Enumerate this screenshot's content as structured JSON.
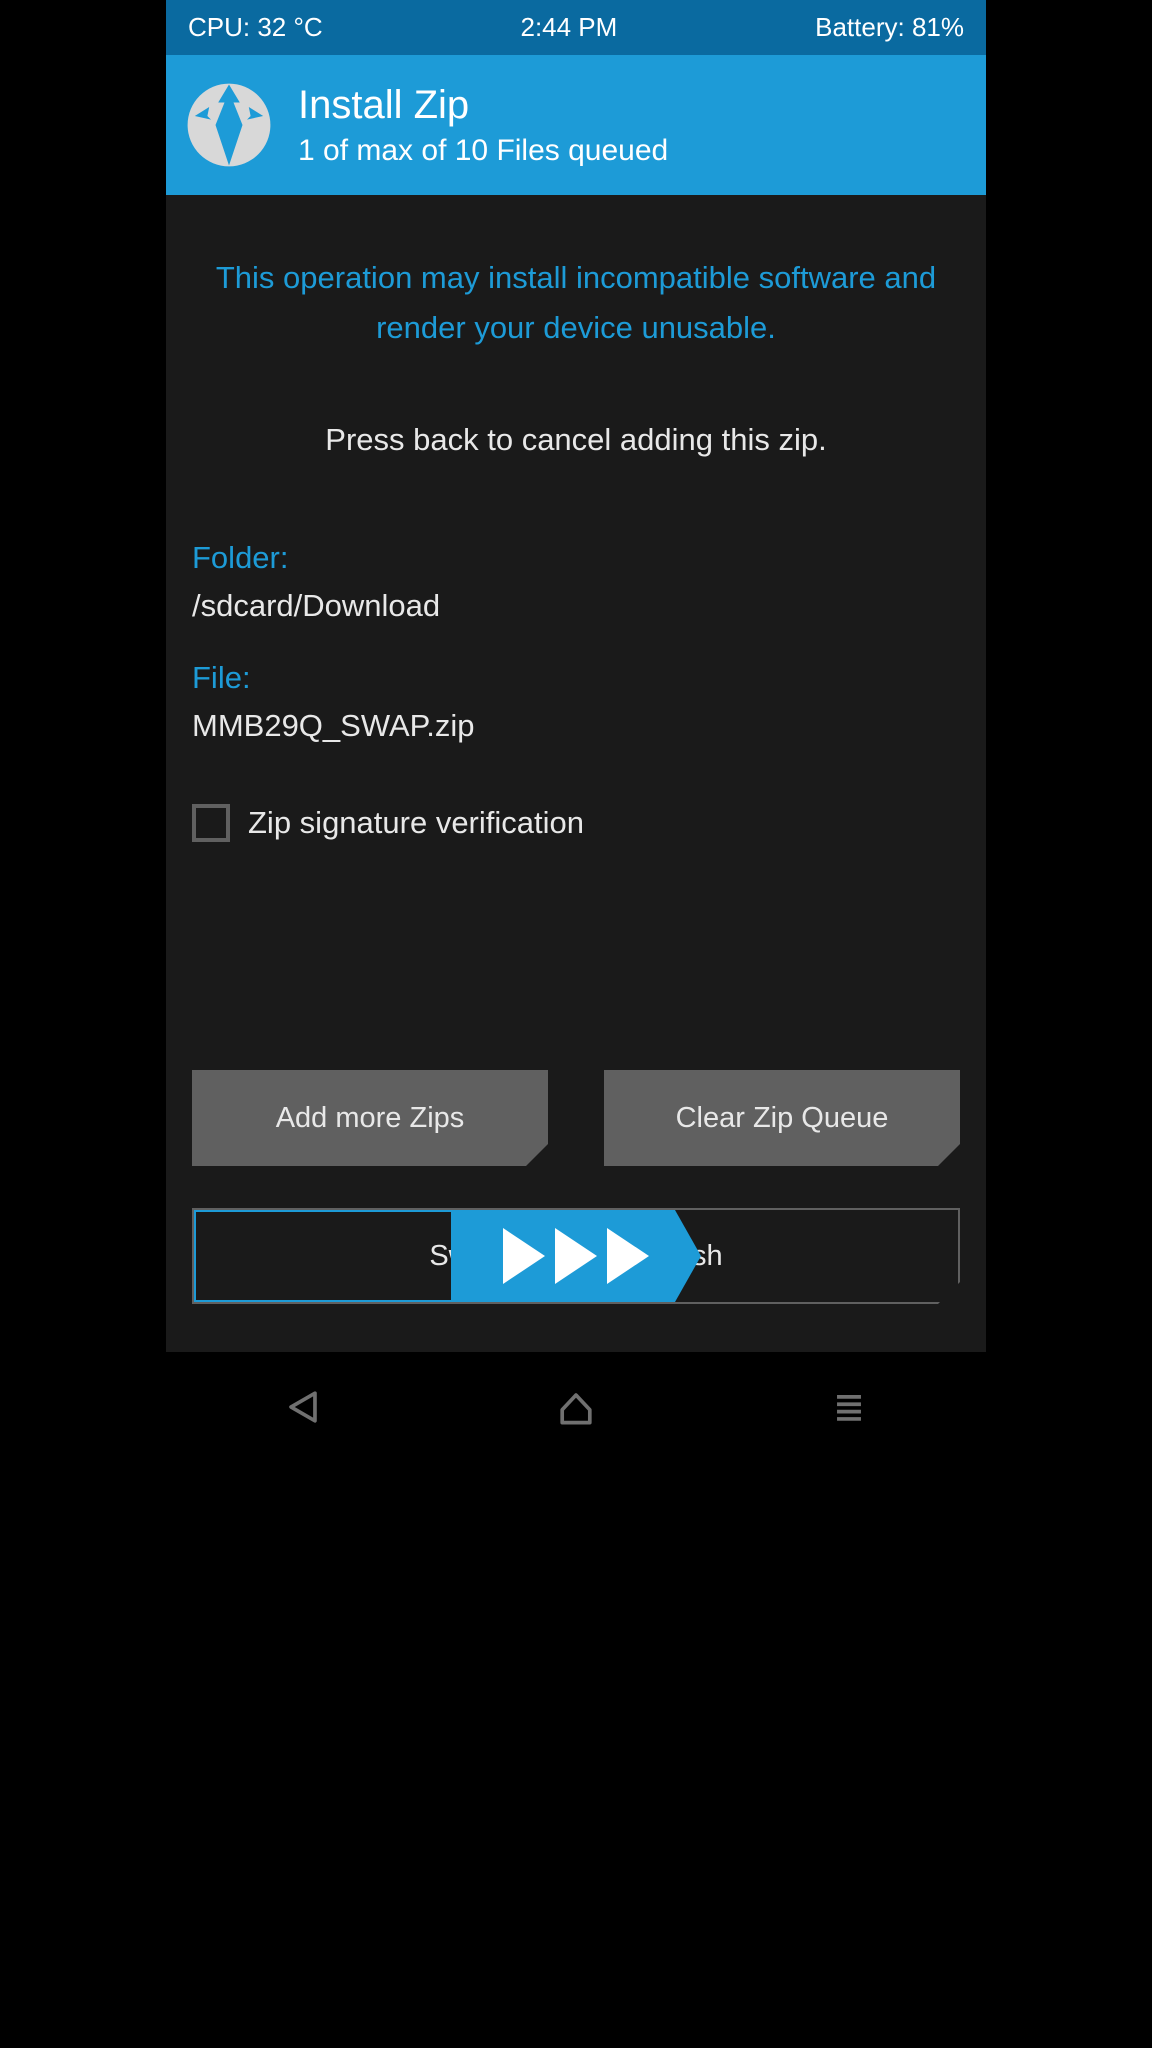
{
  "status_bar": {
    "cpu": "CPU: 32 °C",
    "time": "2:44 PM",
    "battery": "Battery: 81%"
  },
  "header": {
    "title": "Install Zip",
    "subtitle": "1 of max of 10 Files queued"
  },
  "content": {
    "warning": "This operation may install incompatible software and render your device unusable.",
    "instruction": "Press back to cancel adding this zip.",
    "folder_label": "Folder:",
    "folder_value": "/sdcard/Download",
    "file_label": "File:",
    "file_value": "MMB29Q_SWAP.zip",
    "checkbox_label": "Zip signature verification"
  },
  "buttons": {
    "add_more": "Add more Zips",
    "clear_queue": "Clear Zip Queue"
  },
  "slider": {
    "label": "Swipe to confirm Flash"
  }
}
